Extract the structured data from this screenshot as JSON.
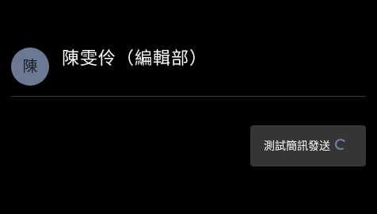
{
  "contact": {
    "avatar_initial": "陳",
    "name": "陳雯伶（編輯部）"
  },
  "message": {
    "text": "測試簡訊發送",
    "status_icon": "sending-spinner-icon"
  },
  "colors": {
    "background": "#000000",
    "avatar_bg": "#6b7a92",
    "bubble_bg": "#353535",
    "divider": "#3a3a3a",
    "spinner_accent": "#6f86a8"
  }
}
